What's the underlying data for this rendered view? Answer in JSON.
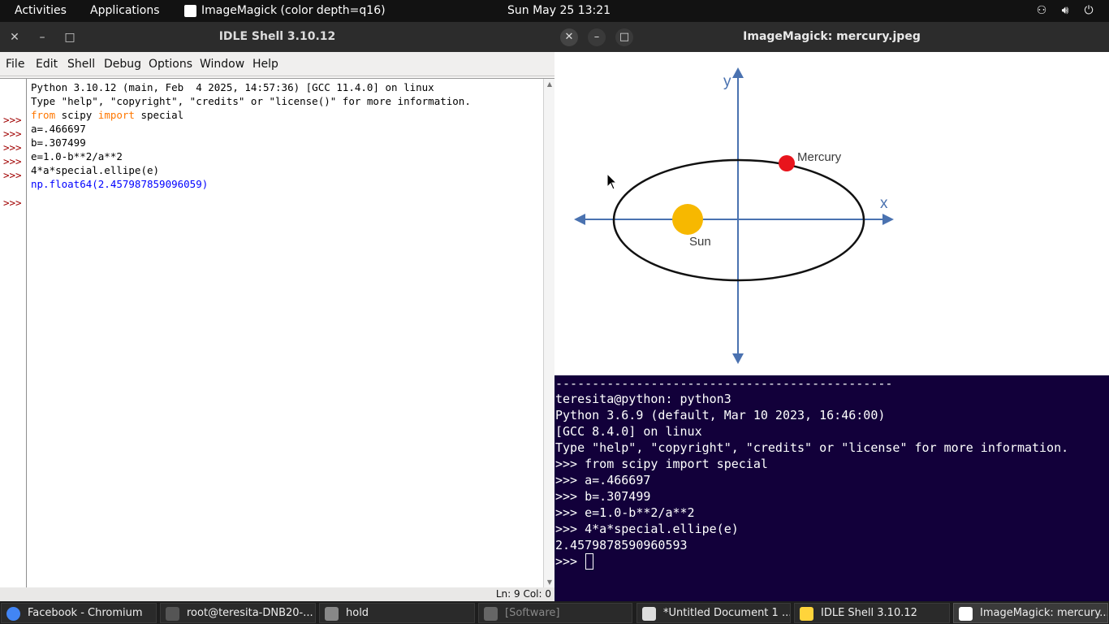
{
  "topbar": {
    "activities": "Activities",
    "applications": "Applications",
    "app_title": "ImageMagick (color depth=q16)",
    "clock": "Sun May 25  13:21",
    "tray_icons": [
      "network-icon",
      "volume-icon",
      "power-icon"
    ]
  },
  "idle": {
    "title": "IDLE Shell 3.10.12",
    "menus": [
      "File",
      "Edit",
      "Shell",
      "Debug",
      "Options",
      "Window",
      "Help"
    ],
    "banner1": "Python 3.10.12 (main, Feb  4 2025, 14:57:36) [GCC 11.4.0] on linux",
    "banner2": "Type \"help\", \"copyright\", \"credits\" or \"license()\" for more information.",
    "prompt": ">>>",
    "cmd1_kw1": "from",
    "cmd1_mid": " scipy ",
    "cmd1_kw2": "import",
    "cmd1_end": " special",
    "cmd2": "a=.466697",
    "cmd3": "b=.307499",
    "cmd4": "e=1.0-b**2/a**2",
    "cmd5": "4*a*special.ellipe(e)",
    "output": "np.float64(2.457987859096059)",
    "status": "Ln: 9  Col: 0"
  },
  "imagemagick": {
    "title": "ImageMagick: mercury.jpeg",
    "diagram": {
      "y_label": "y",
      "x_label": "x",
      "planet_label": "Mercury",
      "star_label": "Sun",
      "planet_color": "#e8141c",
      "star_color": "#f7b800",
      "axis_color": "#4a72b0"
    }
  },
  "terminal": {
    "lines": [
      "----------------------------------------------",
      "teresita@python: python3",
      "Python 3.6.9 (default, Mar 10 2023, 16:46:00)",
      "[GCC 8.4.0] on linux",
      "Type \"help\", \"copyright\", \"credits\" or \"license\" for more information.",
      ">>> from scipy import special",
      ">>> a=.466697",
      ">>> b=.307499",
      ">>> e=1.0-b**2/a**2",
      ">>> 4*a*special.ellipe(e)",
      "2.4579878590960593",
      ">>> "
    ]
  },
  "taskbar": {
    "items": [
      {
        "label": "Facebook - Chromium",
        "icon": "chromium-icon",
        "color": "#4285f4"
      },
      {
        "label": "root@teresita-DNB20-...",
        "icon": "terminal-icon",
        "color": "#555555"
      },
      {
        "label": "hold",
        "icon": "folder-icon",
        "color": "#888888"
      },
      {
        "label": "[Software]",
        "icon": "software-icon",
        "color": "#666666"
      },
      {
        "label": "*Untitled Document 1 ...",
        "icon": "text-editor-icon",
        "color": "#dddddd"
      },
      {
        "label": "IDLE Shell 3.10.12",
        "icon": "python-icon",
        "color": "#ffd43b"
      },
      {
        "label": "ImageMagick: mercury....",
        "icon": "imagemagick-icon",
        "color": "#ffffff"
      }
    ]
  }
}
